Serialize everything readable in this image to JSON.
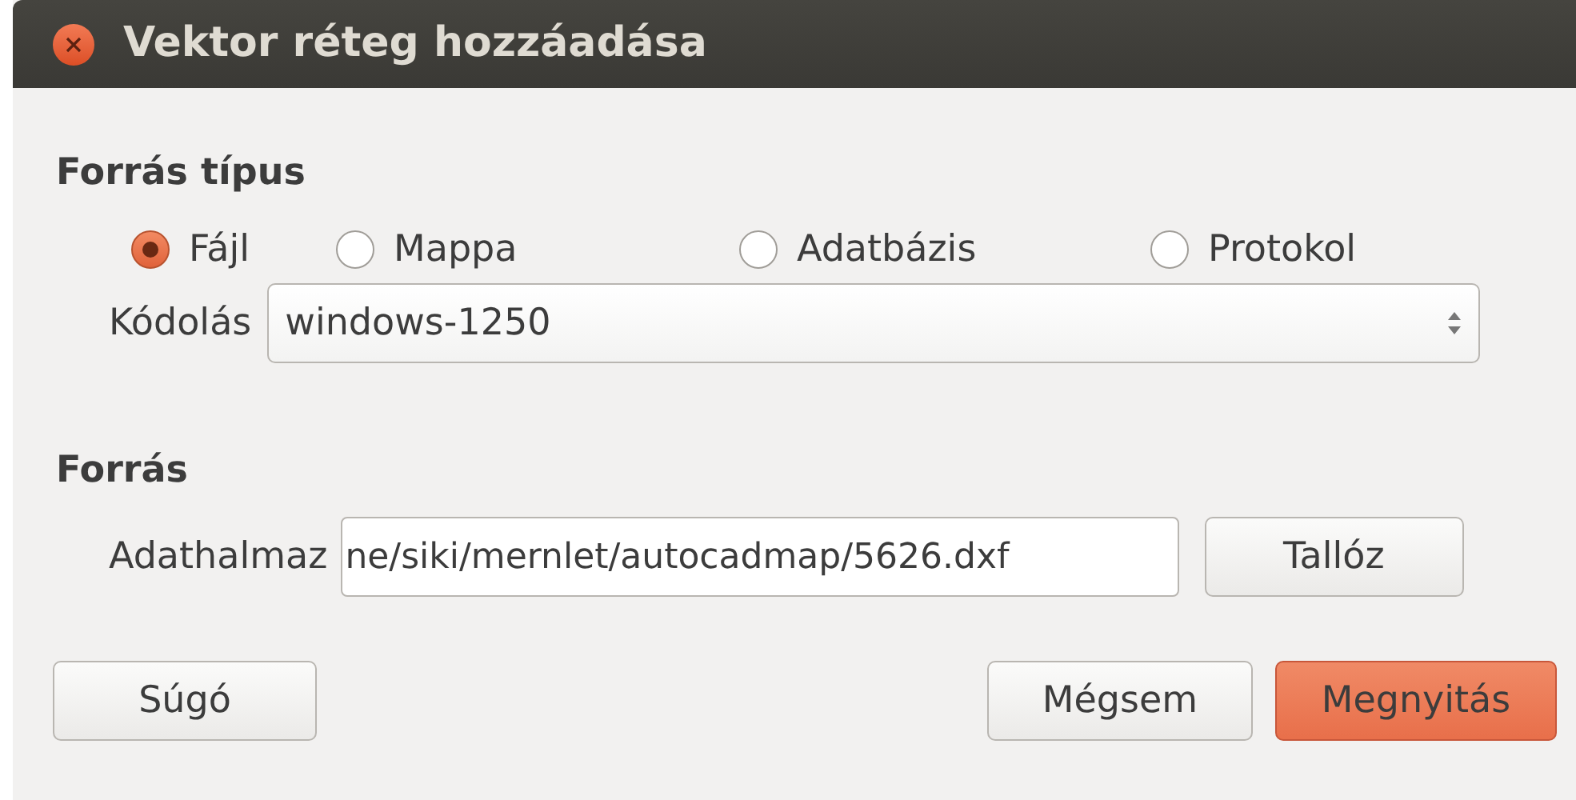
{
  "window": {
    "title": "Vektor réteg hozzáadása"
  },
  "source_type": {
    "heading": "Forrás típus",
    "options": [
      {
        "label": "Fájl",
        "selected": true
      },
      {
        "label": "Mappa",
        "selected": false
      },
      {
        "label": "Adatbázis",
        "selected": false
      },
      {
        "label": "Protokol",
        "selected": false
      }
    ],
    "encoding": {
      "label": "Kódolás",
      "value": "windows-1250"
    }
  },
  "source": {
    "heading": "Forrás",
    "dataset": {
      "label": "Adathalmaz",
      "value": "ne/siki/mernlet/autocadmap/5626.dxf"
    },
    "browse_button": "Tallóz"
  },
  "buttons": [
    {
      "label": "Súgó",
      "kind": "plain"
    },
    {
      "label": "Mégsem",
      "kind": "plain"
    },
    {
      "label": "Megnyitás",
      "kind": "primary"
    }
  ]
}
